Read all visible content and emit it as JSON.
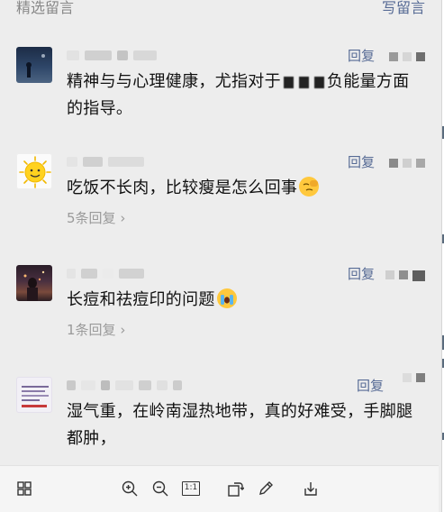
{
  "header": {
    "title": "精选留言",
    "write_label": "写留言"
  },
  "comments": [
    {
      "reply_label": "回复",
      "text_before_mask": "精神与与心理健康，尤指对于",
      "text_after_mask": "负能量方面的指导。",
      "replies_label": ""
    },
    {
      "reply_label": "回复",
      "text": "吃饭不长肉，比较瘦是怎么回事",
      "emoji_icon": "facepalm-emoji",
      "replies_label": "5条回复"
    },
    {
      "reply_label": "回复",
      "text": "长痘和祛痘印的问题",
      "emoji_icon": "crying-emoji",
      "replies_label": "1条回复"
    },
    {
      "reply_label": "回复",
      "text": "湿气重，在岭南湿热地带，真的好难受，手脚腿都肿，",
      "replies_label": ""
    }
  ],
  "toolbar": {
    "icons": [
      "thumbnails-icon",
      "zoom-in-icon",
      "zoom-out-icon",
      "actual-size-icon",
      "rotate-icon",
      "edit-icon",
      "download-icon"
    ],
    "actual_size_label": "1:1"
  },
  "colors": {
    "link": "#576b95",
    "muted": "#888888",
    "background": "#ededed"
  }
}
